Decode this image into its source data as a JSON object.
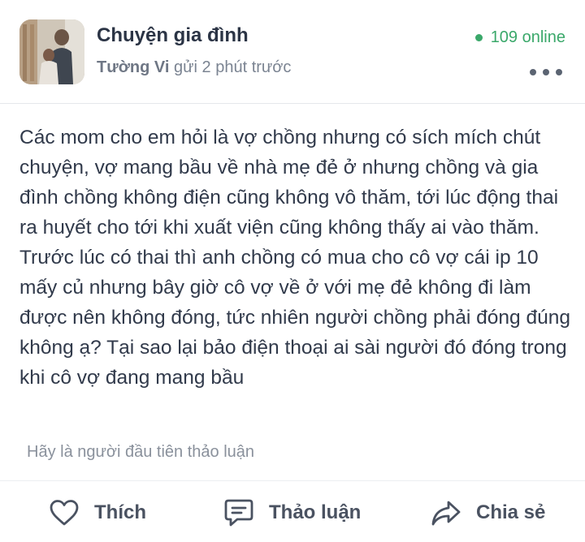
{
  "post": {
    "group_name": "Chuyện gia đình",
    "online_count": "109 online",
    "author": "Tường Vi",
    "time": "gửi 2 phút trước",
    "content": "Các mom cho em hỏi là vợ chồng nhưng có sích mích chút chuyện, vợ mang bầu về nhà mẹ đẻ ở nhưng chồng và gia đình chồng không điện cũng không vô thăm, tới lúc động thai ra huyết cho tới khi xuất viện cũng không thấy ai vào thăm. Trước lúc có thai thì anh chồng có mua cho cô vợ cái ip 10 mấy củ nhưng bây giờ cô vợ về ở với mẹ đẻ không đi làm được nên không đóng, tức nhiên người chồng phải đóng đúng không ạ? Tại sao lại bảo điện thoại ai sài người đó đóng trong khi cô vợ đang mang bầu",
    "empty_note": "Hãy là người đầu tiên thảo luận"
  },
  "actions": {
    "like": "Thích",
    "discuss": "Thảo luận",
    "share": "Chia sẻ"
  },
  "colors": {
    "online": "#3aa86a",
    "text": "#313a4b",
    "muted": "#7b8492"
  },
  "icons": {
    "avatar": "group-avatar-photo",
    "more": "more-dots-icon",
    "like": "heart-icon",
    "discuss": "chat-bubble-icon",
    "share": "share-arrow-icon"
  }
}
